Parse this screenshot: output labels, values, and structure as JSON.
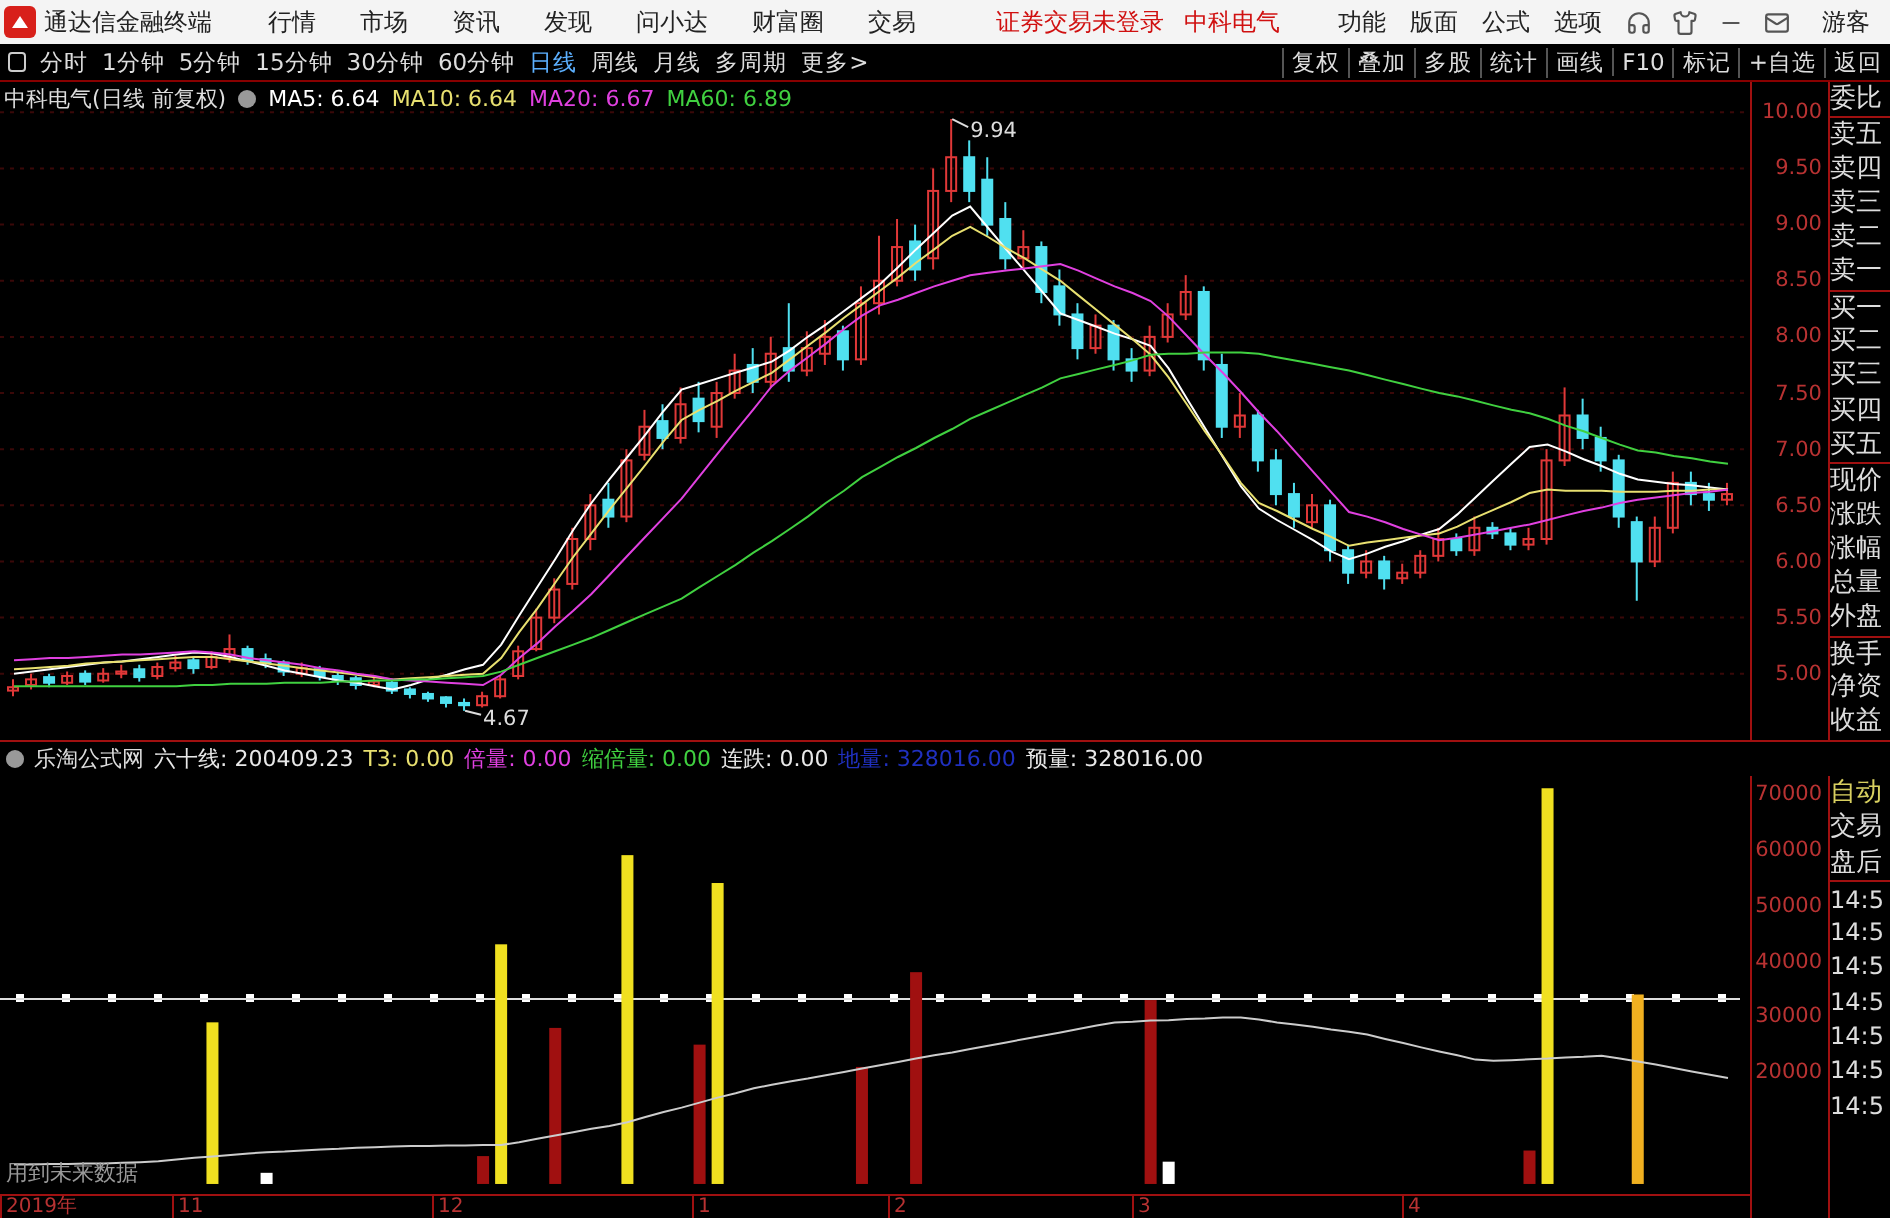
{
  "menu_bar": {
    "app_title": "通达信金融终端",
    "items": [
      "行情",
      "市场",
      "资讯",
      "发现",
      "问小达",
      "财富圈",
      "交易"
    ],
    "login_status": "证券交易未登录",
    "stock_name": "中科电气",
    "right_items": [
      "功能",
      "版面",
      "公式",
      "选项"
    ],
    "user": "游客"
  },
  "toolbar": {
    "periods": [
      {
        "label": "分时",
        "selected": false
      },
      {
        "label": "1分钟",
        "selected": false
      },
      {
        "label": "5分钟",
        "selected": false
      },
      {
        "label": "15分钟",
        "selected": false
      },
      {
        "label": "30分钟",
        "selected": false
      },
      {
        "label": "60分钟",
        "selected": false
      },
      {
        "label": "日线",
        "selected": true
      },
      {
        "label": "周线",
        "selected": false
      },
      {
        "label": "月线",
        "selected": false
      },
      {
        "label": "多周期",
        "selected": false
      }
    ],
    "more": "更多>",
    "actions": [
      "复权",
      "叠加",
      "多股",
      "统计",
      "画线",
      "F10",
      "标记",
      "+自选",
      "返回"
    ]
  },
  "price_chart": {
    "title": "中科电气(日线 前复权)",
    "ma_readings": [
      ": 6.64",
      ": 6.64",
      ": 6.67",
      ": 6.89"
    ],
    "high_label": "9.94",
    "low_label": "4.67",
    "chart_data": {
      "type": "candlestick",
      "ylim": [
        4.41,
        10.27
      ],
      "grid": true,
      "yticks": [
        {
          "value": 10,
          "label": "10.00"
        },
        {
          "value": 9.5,
          "label": "9.50"
        },
        {
          "value": 9,
          "label": "9.00"
        },
        {
          "value": 8.5,
          "label": "8.50"
        },
        {
          "value": 8,
          "label": "8.00"
        },
        {
          "value": 7.5,
          "label": "7.50"
        },
        {
          "value": 7,
          "label": "7.00"
        },
        {
          "value": 6.5,
          "label": "6.50"
        },
        {
          "value": 6,
          "label": "6.00"
        },
        {
          "value": 5.5,
          "label": "5.50"
        },
        {
          "value": 5,
          "label": "5.00"
        }
      ],
      "ohlc": [
        [
          4.85,
          4.95,
          4.8,
          4.88
        ],
        [
          4.9,
          5.0,
          4.86,
          4.95
        ],
        [
          4.97,
          5.0,
          4.88,
          4.92
        ],
        [
          4.92,
          5.02,
          4.9,
          4.98
        ],
        [
          5.0,
          5.03,
          4.9,
          4.93
        ],
        [
          4.94,
          5.05,
          4.92,
          5.0
        ],
        [
          5.0,
          5.08,
          4.96,
          5.02
        ],
        [
          5.04,
          5.08,
          4.93,
          4.97
        ],
        [
          4.98,
          5.1,
          4.95,
          5.06
        ],
        [
          5.05,
          5.16,
          5.02,
          5.1
        ],
        [
          5.12,
          5.15,
          5.0,
          5.05
        ],
        [
          5.06,
          5.2,
          5.04,
          5.15
        ],
        [
          5.14,
          5.35,
          5.1,
          5.22
        ],
        [
          5.22,
          5.25,
          5.08,
          5.12
        ],
        [
          5.13,
          5.18,
          5.05,
          5.1
        ],
        [
          5.1,
          5.12,
          4.98,
          5.02
        ],
        [
          5.0,
          5.1,
          4.97,
          5.05
        ],
        [
          5.04,
          5.07,
          4.94,
          4.98
        ],
        [
          4.98,
          5.02,
          4.9,
          4.95
        ],
        [
          4.96,
          4.98,
          4.86,
          4.9
        ],
        [
          4.9,
          4.98,
          4.88,
          4.93
        ],
        [
          4.92,
          4.94,
          4.82,
          4.85
        ],
        [
          4.86,
          4.88,
          4.78,
          4.82
        ],
        [
          4.82,
          4.84,
          4.75,
          4.78
        ],
        [
          4.79,
          4.8,
          4.7,
          4.74
        ],
        [
          4.74,
          4.78,
          4.67,
          4.72
        ],
        [
          4.72,
          4.84,
          4.7,
          4.8
        ],
        [
          4.8,
          4.98,
          4.78,
          4.95
        ],
        [
          4.98,
          5.25,
          4.95,
          5.2
        ],
        [
          5.22,
          5.58,
          5.2,
          5.5
        ],
        [
          5.5,
          5.85,
          5.45,
          5.75
        ],
        [
          5.8,
          6.3,
          5.75,
          6.2
        ],
        [
          6.2,
          6.6,
          6.1,
          6.5
        ],
        [
          6.55,
          6.7,
          6.3,
          6.4
        ],
        [
          6.4,
          7.0,
          6.35,
          6.9
        ],
        [
          6.95,
          7.35,
          6.9,
          7.2
        ],
        [
          7.25,
          7.4,
          7.0,
          7.1
        ],
        [
          7.1,
          7.55,
          7.05,
          7.4
        ],
        [
          7.45,
          7.6,
          7.15,
          7.25
        ],
        [
          7.2,
          7.6,
          7.1,
          7.5
        ],
        [
          7.5,
          7.85,
          7.45,
          7.7
        ],
        [
          7.75,
          7.9,
          7.5,
          7.6
        ],
        [
          7.6,
          8.0,
          7.55,
          7.85
        ],
        [
          7.9,
          8.3,
          7.6,
          7.7
        ],
        [
          7.7,
          8.05,
          7.65,
          7.9
        ],
        [
          7.85,
          8.15,
          7.75,
          8.0
        ],
        [
          8.05,
          8.1,
          7.7,
          7.8
        ],
        [
          7.8,
          8.45,
          7.75,
          8.3
        ],
        [
          8.3,
          8.9,
          8.2,
          8.5
        ],
        [
          8.5,
          9.05,
          8.45,
          8.8
        ],
        [
          8.85,
          9.0,
          8.5,
          8.6
        ],
        [
          8.7,
          9.5,
          8.6,
          9.3
        ],
        [
          9.3,
          9.94,
          9.2,
          9.6
        ],
        [
          9.6,
          9.75,
          9.2,
          9.3
        ],
        [
          9.4,
          9.6,
          8.9,
          9.0
        ],
        [
          9.05,
          9.2,
          8.6,
          8.7
        ],
        [
          8.7,
          8.95,
          8.6,
          8.8
        ],
        [
          8.8,
          8.85,
          8.3,
          8.4
        ],
        [
          8.45,
          8.6,
          8.1,
          8.2
        ],
        [
          8.2,
          8.3,
          7.8,
          7.9
        ],
        [
          7.9,
          8.2,
          7.85,
          8.1
        ],
        [
          8.1,
          8.15,
          7.7,
          7.8
        ],
        [
          7.8,
          7.9,
          7.6,
          7.7
        ],
        [
          7.7,
          8.1,
          7.65,
          8.0
        ],
        [
          8.0,
          8.3,
          7.95,
          8.2
        ],
        [
          8.2,
          8.55,
          8.15,
          8.4
        ],
        [
          8.4,
          8.45,
          7.7,
          7.8
        ],
        [
          7.75,
          7.85,
          7.1,
          7.2
        ],
        [
          7.2,
          7.5,
          7.1,
          7.3
        ],
        [
          7.3,
          7.35,
          6.8,
          6.9
        ],
        [
          6.9,
          7.0,
          6.5,
          6.6
        ],
        [
          6.6,
          6.7,
          6.3,
          6.4
        ],
        [
          6.35,
          6.6,
          6.3,
          6.5
        ],
        [
          6.5,
          6.55,
          6.0,
          6.1
        ],
        [
          6.1,
          6.15,
          5.8,
          5.9
        ],
        [
          5.9,
          6.1,
          5.85,
          6.0
        ],
        [
          6.0,
          6.05,
          5.75,
          5.85
        ],
        [
          5.85,
          5.98,
          5.8,
          5.9
        ],
        [
          5.9,
          6.1,
          5.85,
          6.05
        ],
        [
          6.05,
          6.3,
          6.0,
          6.2
        ],
        [
          6.2,
          6.25,
          6.05,
          6.1
        ],
        [
          6.1,
          6.4,
          6.05,
          6.3
        ],
        [
          6.3,
          6.35,
          6.2,
          6.25
        ],
        [
          6.25,
          6.3,
          6.1,
          6.15
        ],
        [
          6.15,
          6.3,
          6.1,
          6.2
        ],
        [
          6.2,
          7.0,
          6.15,
          6.9
        ],
        [
          6.9,
          7.55,
          6.85,
          7.3
        ],
        [
          7.3,
          7.45,
          7.0,
          7.1
        ],
        [
          7.1,
          7.2,
          6.8,
          6.9
        ],
        [
          6.9,
          6.95,
          6.3,
          6.4
        ],
        [
          6.35,
          6.4,
          5.65,
          6.0
        ],
        [
          6.0,
          6.4,
          5.95,
          6.3
        ],
        [
          6.3,
          6.8,
          6.25,
          6.7
        ],
        [
          6.7,
          6.8,
          6.5,
          6.6
        ],
        [
          6.6,
          6.7,
          6.45,
          6.55
        ],
        [
          6.55,
          6.7,
          6.5,
          6.6
        ]
      ],
      "series": [
        {
          "name": "MA5",
          "type": "line",
          "color": "#ffffff",
          "values": [
            5.0,
            5.02,
            5.04,
            5.06,
            5.08,
            5.1,
            5.11,
            5.13,
            5.15,
            5.17,
            5.19,
            5.18,
            5.15,
            5.11,
            5.07,
            5.03,
            5.0,
            4.97,
            4.94,
            4.92,
            4.89,
            4.86,
            4.9,
            4.95,
            4.99,
            5.04,
            5.08,
            5.26,
            5.52,
            5.77,
            6.02,
            6.28,
            6.52,
            6.73,
            6.93,
            7.13,
            7.34,
            7.53,
            7.58,
            7.63,
            7.68,
            7.73,
            7.78,
            7.88,
            8.0,
            8.11,
            8.23,
            8.35,
            8.47,
            8.62,
            8.78,
            8.93,
            9.08,
            9.16,
            8.97,
            8.78,
            8.59,
            8.4,
            8.21,
            8.15,
            8.09,
            8.03,
            7.98,
            7.92,
            7.72,
            7.45,
            7.19,
            6.93,
            6.67,
            6.47,
            6.37,
            6.28,
            6.19,
            6.09,
            6.02,
            6.07,
            6.13,
            6.18,
            6.24,
            6.29,
            6.42,
            6.57,
            6.72,
            6.87,
            7.02,
            7.04,
            6.98,
            6.91,
            6.85,
            6.78,
            6.73,
            6.71,
            6.69,
            6.68,
            6.66,
            6.64
          ]
        },
        {
          "name": "MA10",
          "type": "line",
          "color": "#e8e070",
          "values": [
            5.04,
            5.05,
            5.06,
            5.07,
            5.09,
            5.1,
            5.11,
            5.12,
            5.13,
            5.14,
            5.15,
            5.15,
            5.13,
            5.11,
            5.09,
            5.07,
            5.05,
            5.03,
            5.01,
            4.99,
            4.97,
            4.95,
            4.96,
            4.97,
            4.98,
            4.99,
            5.0,
            5.14,
            5.37,
            5.58,
            5.81,
            6.04,
            6.25,
            6.46,
            6.66,
            6.86,
            7.07,
            7.26,
            7.35,
            7.43,
            7.52,
            7.6,
            7.68,
            7.8,
            7.92,
            8.04,
            8.17,
            8.29,
            8.41,
            8.53,
            8.66,
            8.78,
            8.9,
            8.98,
            8.89,
            8.79,
            8.7,
            8.6,
            8.5,
            8.37,
            8.24,
            8.11,
            7.98,
            7.84,
            7.64,
            7.4,
            7.16,
            6.94,
            6.7,
            6.52,
            6.45,
            6.37,
            6.29,
            6.22,
            6.14,
            6.17,
            6.19,
            6.21,
            6.23,
            6.25,
            6.31,
            6.39,
            6.46,
            6.53,
            6.61,
            6.64,
            6.63,
            6.63,
            6.63,
            6.62,
            6.62,
            6.62,
            6.63,
            6.63,
            6.64,
            6.64
          ]
        },
        {
          "name": "MA20",
          "type": "line",
          "color": "#e040e0",
          "values": [
            5.12,
            5.13,
            5.14,
            5.14,
            5.15,
            5.16,
            5.17,
            5.17,
            5.18,
            5.19,
            5.2,
            5.19,
            5.17,
            5.14,
            5.12,
            5.1,
            5.08,
            5.05,
            5.03,
            5.0,
            4.98,
            4.95,
            4.94,
            4.93,
            4.92,
            4.91,
            4.9,
            4.99,
            5.14,
            5.27,
            5.42,
            5.56,
            5.71,
            5.88,
            6.05,
            6.22,
            6.39,
            6.56,
            6.76,
            6.96,
            7.16,
            7.36,
            7.56,
            7.7,
            7.82,
            7.94,
            8.07,
            8.19,
            8.28,
            8.33,
            8.39,
            8.45,
            8.5,
            8.55,
            8.57,
            8.59,
            8.61,
            8.63,
            8.65,
            8.59,
            8.52,
            8.45,
            8.39,
            8.32,
            8.18,
            8.01,
            7.84,
            7.68,
            7.51,
            7.33,
            7.16,
            6.98,
            6.8,
            6.62,
            6.44,
            6.4,
            6.35,
            6.29,
            6.24,
            6.19,
            6.21,
            6.24,
            6.27,
            6.3,
            6.33,
            6.37,
            6.41,
            6.45,
            6.48,
            6.52,
            6.55,
            6.57,
            6.59,
            6.61,
            6.62,
            6.64
          ]
        },
        {
          "name": "MA60",
          "type": "line",
          "color": "#40d040",
          "values": [
            4.89,
            4.89,
            4.89,
            4.89,
            4.89,
            4.89,
            4.89,
            4.89,
            4.89,
            4.89,
            4.9,
            4.9,
            4.91,
            4.91,
            4.91,
            4.92,
            4.92,
            4.92,
            4.93,
            4.93,
            4.94,
            4.94,
            4.95,
            4.95,
            4.96,
            4.97,
            4.98,
            5.02,
            5.08,
            5.14,
            5.2,
            5.26,
            5.32,
            5.39,
            5.46,
            5.53,
            5.6,
            5.67,
            5.77,
            5.87,
            5.97,
            6.08,
            6.18,
            6.29,
            6.4,
            6.52,
            6.63,
            6.75,
            6.84,
            6.93,
            7.01,
            7.1,
            7.18,
            7.27,
            7.34,
            7.41,
            7.48,
            7.55,
            7.63,
            7.67,
            7.71,
            7.75,
            7.79,
            7.84,
            7.85,
            7.85,
            7.86,
            7.86,
            7.86,
            7.85,
            7.82,
            7.79,
            7.76,
            7.73,
            7.7,
            7.66,
            7.62,
            7.58,
            7.54,
            7.5,
            7.47,
            7.43,
            7.39,
            7.35,
            7.32,
            7.27,
            7.21,
            7.16,
            7.1,
            7.04,
            6.99,
            6.97,
            6.94,
            6.92,
            6.89,
            6.87
          ]
        }
      ]
    }
  },
  "indicator_panel": {
    "name": "乐淘公式网",
    "values": [
      {
        "label": "六十线: 200409.23",
        "color": "#e8e8e8"
      },
      {
        "label": "T3: 0.00",
        "color": "#e8e070"
      },
      {
        "label": "倍量: 0.00",
        "color": "#e040e0"
      },
      {
        "label": "缩倍量: 0.00",
        "color": "#40d040"
      },
      {
        "label": "连跌: 0.00",
        "color": "#e8e8e8"
      },
      {
        "label": "地量: 328016.00",
        "color": "#2030c0"
      },
      {
        "label": "预量: 328016.00",
        "color": "#e8e8e8"
      }
    ],
    "note": "用到未来数据",
    "chart_data": {
      "type": "bar",
      "ylim": [
        -1800,
        73200
      ],
      "yticks": [
        {
          "value": 70000,
          "label": "70000"
        },
        {
          "value": 60000,
          "label": "60000"
        },
        {
          "value": 50000,
          "label": "50000"
        },
        {
          "value": 40000,
          "label": "40000"
        },
        {
          "value": 30000,
          "label": "30000"
        },
        {
          "value": 20000,
          "label": "20000"
        }
      ],
      "series": [
        {
          "color": "#f0e020",
          "values": [
            null,
            null,
            null,
            null,
            null,
            null,
            null,
            null,
            null,
            null,
            null,
            29000,
            null,
            null,
            null,
            null,
            null,
            null,
            null,
            null,
            null,
            null,
            null,
            null,
            null,
            null,
            null,
            43000,
            null,
            null,
            null,
            null,
            null,
            null,
            59000,
            null,
            null,
            null,
            null,
            54000,
            null,
            null,
            null,
            null,
            null,
            null,
            null,
            null,
            null,
            null,
            null,
            null,
            null,
            null,
            null,
            null,
            null,
            null,
            null,
            null,
            null,
            null,
            null,
            null,
            null,
            null,
            null,
            null,
            null,
            null,
            null,
            null,
            null,
            null,
            null,
            null,
            null,
            null,
            null,
            null,
            null,
            null,
            null,
            null,
            null,
            71000,
            null,
            null,
            null,
            null,
            null,
            null,
            null,
            null,
            null,
            null
          ]
        },
        {
          "color": "#f0b020",
          "values": [
            null,
            null,
            null,
            null,
            null,
            null,
            null,
            null,
            null,
            null,
            null,
            null,
            null,
            null,
            null,
            null,
            null,
            null,
            null,
            null,
            null,
            null,
            null,
            null,
            null,
            null,
            null,
            null,
            null,
            null,
            null,
            null,
            null,
            null,
            null,
            null,
            null,
            null,
            null,
            null,
            null,
            null,
            null,
            null,
            null,
            null,
            null,
            null,
            null,
            null,
            null,
            null,
            null,
            null,
            null,
            null,
            null,
            null,
            null,
            null,
            null,
            null,
            null,
            null,
            null,
            null,
            null,
            null,
            null,
            null,
            null,
            null,
            null,
            null,
            null,
            null,
            null,
            null,
            null,
            null,
            null,
            null,
            null,
            null,
            null,
            null,
            null,
            null,
            null,
            null,
            34000,
            null,
            null,
            null,
            null,
            null
          ]
        },
        {
          "color": "#a01010",
          "values": [
            null,
            null,
            null,
            null,
            null,
            null,
            null,
            null,
            null,
            null,
            null,
            null,
            null,
            null,
            null,
            null,
            null,
            null,
            null,
            null,
            null,
            null,
            null,
            null,
            null,
            null,
            5000,
            null,
            null,
            null,
            28000,
            null,
            null,
            null,
            null,
            null,
            null,
            null,
            25000,
            null,
            null,
            null,
            null,
            null,
            null,
            null,
            null,
            21000,
            null,
            null,
            38000,
            null,
            null,
            null,
            null,
            null,
            null,
            null,
            null,
            null,
            null,
            null,
            null,
            33000,
            null,
            null,
            null,
            null,
            null,
            null,
            null,
            null,
            null,
            null,
            null,
            null,
            null,
            null,
            null,
            null,
            null,
            null,
            null,
            null,
            6000,
            null,
            null,
            null,
            null,
            null,
            null,
            null,
            null,
            null,
            null,
            null
          ]
        },
        {
          "color": "#ffffff",
          "values": [
            null,
            null,
            null,
            null,
            null,
            null,
            null,
            null,
            null,
            null,
            null,
            null,
            null,
            null,
            2000,
            null,
            null,
            null,
            null,
            null,
            null,
            null,
            null,
            null,
            null,
            null,
            null,
            null,
            null,
            null,
            null,
            null,
            null,
            null,
            null,
            null,
            null,
            null,
            null,
            null,
            null,
            null,
            null,
            null,
            null,
            null,
            null,
            null,
            null,
            null,
            null,
            null,
            null,
            null,
            null,
            null,
            null,
            null,
            null,
            null,
            null,
            null,
            null,
            null,
            4000,
            null,
            null,
            null,
            null,
            null,
            null,
            null,
            null,
            null,
            null,
            null,
            null,
            null,
            null,
            null,
            null,
            null,
            null,
            null,
            null,
            null,
            null,
            null,
            null,
            null,
            null,
            null,
            null,
            null,
            null,
            null
          ]
        },
        {
          "type": "line",
          "color": "#cccccc",
          "values": [
            3500,
            3500,
            3600,
            3600,
            3700,
            3700,
            3800,
            3900,
            4100,
            4400,
            4700,
            4900,
            5200,
            5500,
            5700,
            5800,
            6000,
            6200,
            6300,
            6500,
            6600,
            6700,
            6800,
            6800,
            6900,
            6900,
            7000,
            7000,
            7500,
            8100,
            8700,
            9300,
            9900,
            10400,
            11100,
            12000,
            12900,
            13700,
            14600,
            15500,
            16300,
            17200,
            17800,
            18400,
            18900,
            19500,
            20100,
            20700,
            21300,
            21900,
            22500,
            23100,
            23600,
            24200,
            24800,
            25400,
            26000,
            26600,
            27200,
            27800,
            28400,
            29000,
            29100,
            29300,
            29400,
            29600,
            29700,
            29900,
            29900,
            29500,
            29000,
            28600,
            28200,
            27700,
            27300,
            26800,
            26000,
            25300,
            24500,
            23800,
            23100,
            22300,
            22100,
            22200,
            22400,
            22500,
            22700,
            22800,
            23000,
            22500,
            22000,
            21400,
            20800,
            20200,
            19600,
            19000
          ]
        }
      ]
    }
  },
  "date_axis": [
    "2019年",
    "11",
    "12",
    "1",
    "2",
    "3",
    "4"
  ],
  "quote_panel": {
    "upper": [
      "委比",
      "卖五",
      "卖四",
      "卖三",
      "卖二",
      "卖一",
      "买一",
      "买二",
      "买三",
      "买四",
      "买五",
      "现价",
      "涨跌",
      "涨幅",
      "总量",
      "外盘",
      "换手",
      "净资",
      "收益"
    ],
    "lower": [
      {
        "label": "自动",
        "kind": "mode"
      },
      {
        "label": "交易",
        "kind": "label"
      },
      {
        "label": "盘后",
        "kind": "label"
      },
      {
        "label": "14:5",
        "kind": "time"
      },
      {
        "label": "14:5",
        "kind": "time"
      },
      {
        "label": "14:5",
        "kind": "time"
      },
      {
        "label": "14:5",
        "kind": "time"
      },
      {
        "label": "14:5",
        "kind": "time"
      },
      {
        "label": "14:5",
        "kind": "time"
      },
      {
        "label": "14:5",
        "kind": "time"
      }
    ]
  }
}
